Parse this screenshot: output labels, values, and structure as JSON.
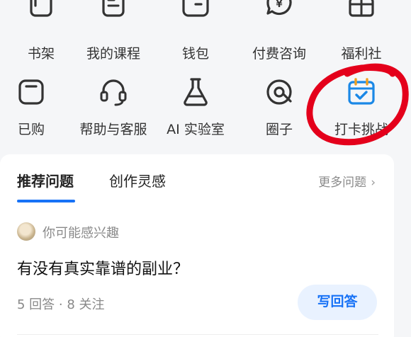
{
  "grid": {
    "row1": [
      {
        "label": "书架",
        "icon": "bookshelf-icon"
      },
      {
        "label": "我的课程",
        "icon": "course-icon"
      },
      {
        "label": "钱包",
        "icon": "wallet-icon"
      },
      {
        "label": "付费咨询",
        "icon": "paid-consult-icon"
      },
      {
        "label": "福利社",
        "icon": "gift-icon"
      }
    ],
    "row2": [
      {
        "label": "已购",
        "icon": "purchased-icon"
      },
      {
        "label": "帮助与客服",
        "icon": "headset-icon"
      },
      {
        "label": "AI 实验室",
        "icon": "flask-icon"
      },
      {
        "label": "圈子",
        "icon": "circle-icon"
      },
      {
        "label": "打卡挑战",
        "icon": "checkin-calendar-icon"
      }
    ]
  },
  "highlight_color": "#e4001b",
  "accent_color": "#1772f6",
  "tabs": {
    "recommend": "推荐问题",
    "inspiration": "创作灵感",
    "more": "更多问题"
  },
  "feed": {
    "interest_label": "你可能感兴趣",
    "question": "有没有真实靠谱的副业？",
    "stats": "5 回答 · 8 关注",
    "answer_button": "写回答"
  }
}
